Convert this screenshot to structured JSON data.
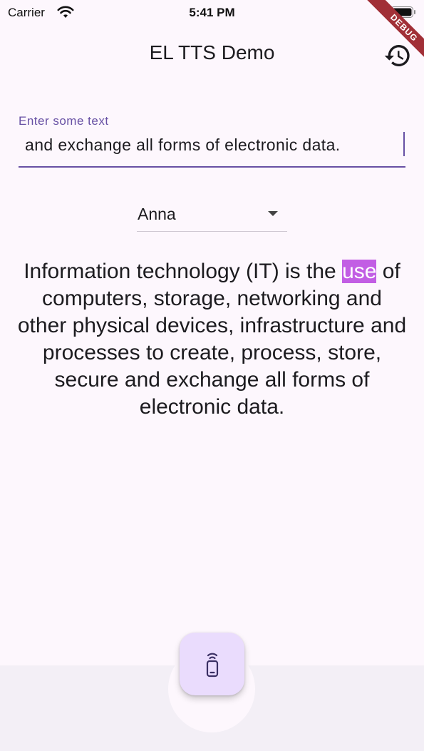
{
  "status_bar": {
    "carrier": "Carrier",
    "time": "5:41 PM",
    "debug_label": "DEBUG"
  },
  "app_bar": {
    "title": "EL TTS Demo",
    "history_icon": "history-icon"
  },
  "text_input": {
    "label": "Enter some text",
    "value": "and exchange all forms of electronic data."
  },
  "voice_dropdown": {
    "selected": "Anna"
  },
  "spoken": {
    "before": "Information technology (IT) is the ",
    "highlighted": "use",
    "after": " of computers, storage, networking and other physical devices, infrastructure and processes to create, process, store, secure and exchange all forms of electronic data."
  },
  "fab": {
    "icon": "speaker-remote-icon"
  },
  "colors": {
    "accent": "#6750a4",
    "highlight": "#c25ee4",
    "background": "#fdf7fd",
    "fab": "#eadcfd"
  }
}
